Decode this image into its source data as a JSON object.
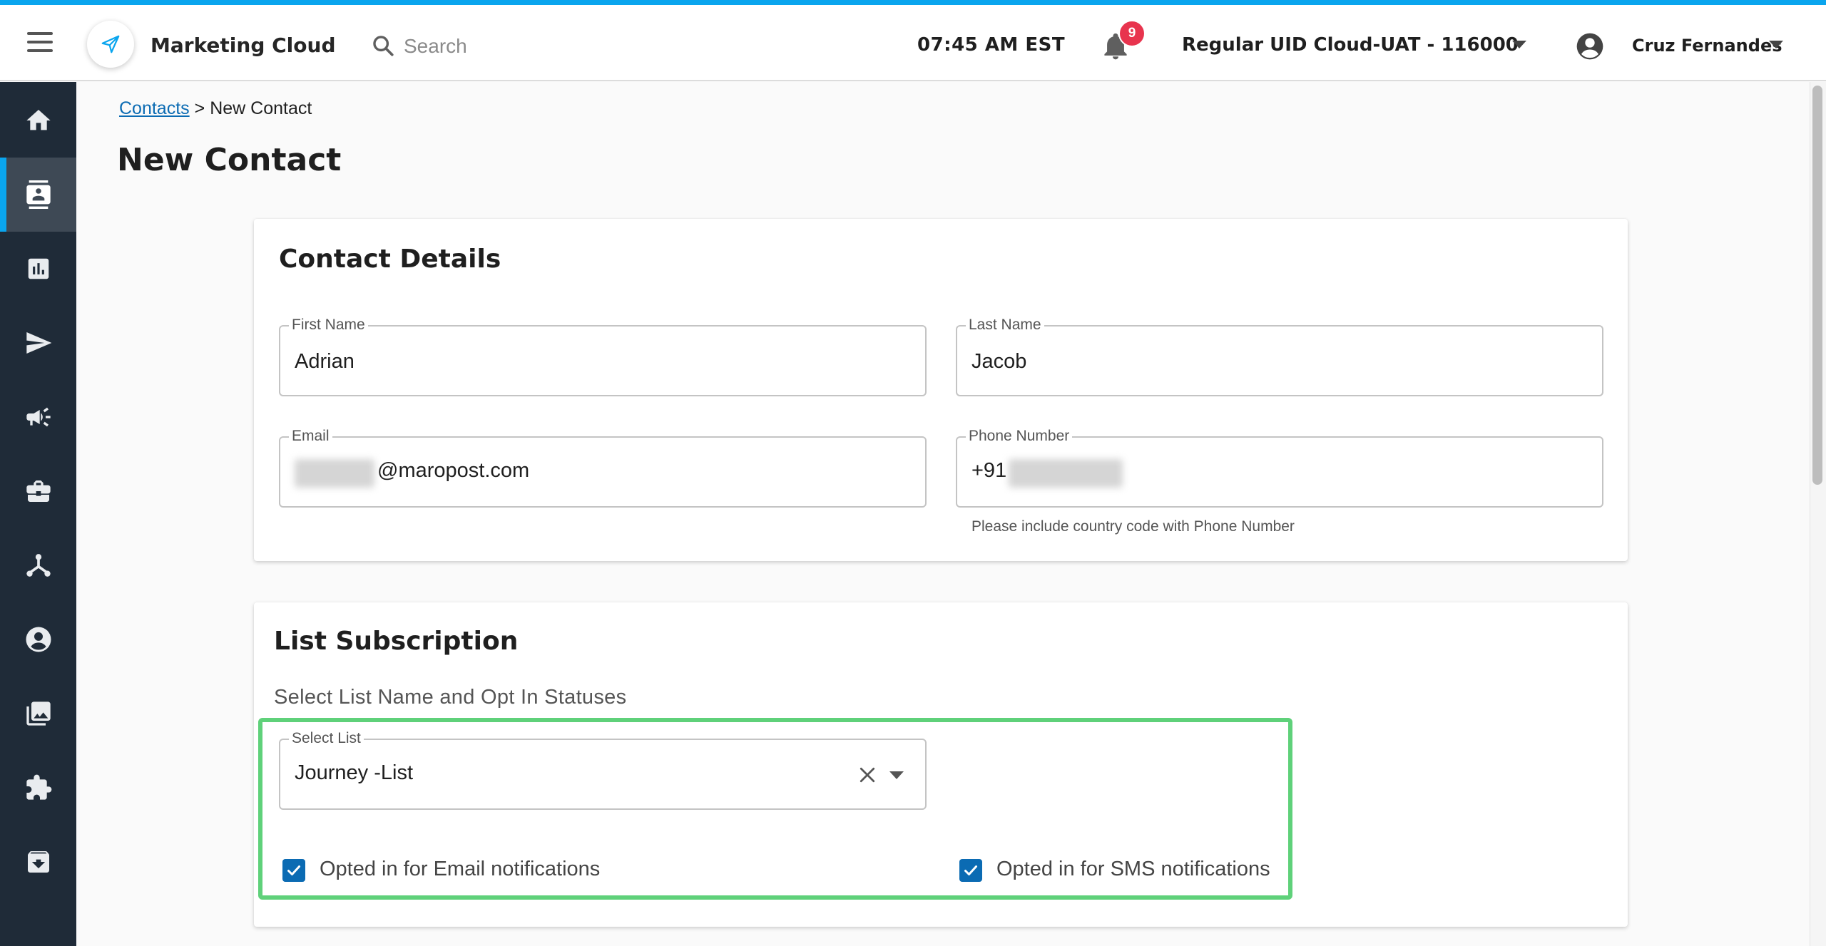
{
  "header": {
    "app_name": "Marketing Cloud",
    "search_placeholder": "Search",
    "time": "07:45 AM EST",
    "notification_count": "9",
    "account": "Regular UID Cloud-UAT - 116000",
    "user_name": "Cruz Fernandes"
  },
  "sidebar": {
    "items": [
      {
        "icon": "home-icon"
      },
      {
        "icon": "contacts-icon",
        "active": true
      },
      {
        "icon": "reports-icon"
      },
      {
        "icon": "send-icon"
      },
      {
        "icon": "megaphone-icon"
      },
      {
        "icon": "briefcase-icon"
      },
      {
        "icon": "journey-icon"
      },
      {
        "icon": "account-icon"
      },
      {
        "icon": "media-library-icon"
      },
      {
        "icon": "integrations-icon"
      },
      {
        "icon": "archive-icon"
      }
    ]
  },
  "breadcrumb": {
    "link": "Contacts",
    "separator": ">",
    "current": "New Contact"
  },
  "page_title": "New Contact",
  "contact_details": {
    "title": "Contact Details",
    "first_name_label": "First Name",
    "first_name_value": "Adrian",
    "last_name_label": "Last Name",
    "last_name_value": "Jacob",
    "email_label": "Email",
    "email_domain": "@maropost.com",
    "phone_label": "Phone Number",
    "phone_prefix": "+91",
    "phone_helper": "Please include country code with Phone Number"
  },
  "list_subscription": {
    "title": "List Subscription",
    "subtitle": "Select List Name and Opt In Statuses",
    "select_label": "Select List",
    "select_value": "Journey -List",
    "email_opt_in_label": "Opted in for Email notifications",
    "email_opt_in_checked": true,
    "sms_opt_in_label": "Opted in for SMS notifications",
    "sms_opt_in_checked": true
  },
  "colors": {
    "accent": "#0aa5ee",
    "sidebar_bg": "#1f2b38",
    "checkbox": "#0b6bb3",
    "badge": "#e8344e",
    "highlight": "#5fd17a"
  }
}
